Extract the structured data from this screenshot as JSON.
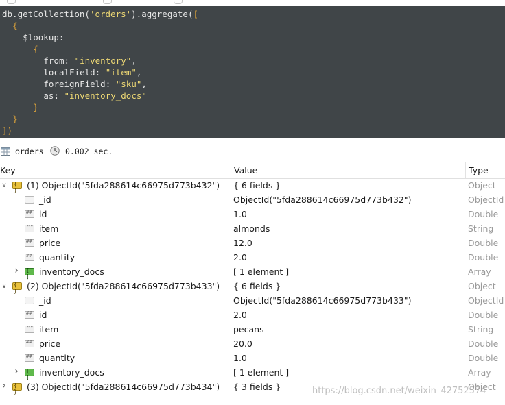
{
  "editor": {
    "lines": [
      {
        "indent": 0,
        "parts": [
          {
            "t": "db.getCollection(",
            "c": "c-plain"
          },
          {
            "t": "'orders'",
            "c": "c-str"
          },
          {
            "t": ").aggregate(",
            "c": "c-plain"
          },
          {
            "t": "[",
            "c": "c-bracket"
          }
        ]
      },
      {
        "indent": 2,
        "parts": [
          {
            "t": "{",
            "c": "c-bracket"
          }
        ]
      },
      {
        "indent": 4,
        "parts": [
          {
            "t": "$lookup:",
            "c": "c-key"
          }
        ]
      },
      {
        "indent": 6,
        "parts": [
          {
            "t": "{",
            "c": "c-bracket"
          }
        ]
      },
      {
        "indent": 8,
        "parts": [
          {
            "t": "from: ",
            "c": "c-key"
          },
          {
            "t": "\"inventory\"",
            "c": "c-str"
          },
          {
            "t": ",",
            "c": "c-plain"
          }
        ]
      },
      {
        "indent": 8,
        "parts": [
          {
            "t": "localField: ",
            "c": "c-key"
          },
          {
            "t": "\"item\"",
            "c": "c-str"
          },
          {
            "t": ",",
            "c": "c-plain"
          }
        ]
      },
      {
        "indent": 8,
        "parts": [
          {
            "t": "foreignField: ",
            "c": "c-key"
          },
          {
            "t": "\"sku\"",
            "c": "c-str"
          },
          {
            "t": ",",
            "c": "c-plain"
          }
        ]
      },
      {
        "indent": 8,
        "parts": [
          {
            "t": "as: ",
            "c": "c-key"
          },
          {
            "t": "\"inventory_docs\"",
            "c": "c-str"
          }
        ]
      },
      {
        "indent": 6,
        "parts": [
          {
            "t": "}",
            "c": "c-bracket"
          }
        ]
      },
      {
        "indent": 2,
        "parts": [
          {
            "t": "}",
            "c": "c-bracket"
          }
        ]
      },
      {
        "indent": 0,
        "parts": [
          {
            "t": "])",
            "c": "c-bracket"
          }
        ]
      }
    ]
  },
  "status": {
    "collection": "orders",
    "time": "0.002 sec."
  },
  "grid": {
    "headers": {
      "key": "Key",
      "value": "Value",
      "type": "Type"
    },
    "rows": [
      {
        "level": 0,
        "arrow": "down",
        "icon": "object",
        "key": "(1) ObjectId(\"5fda288614c66975d773b432\")",
        "value": "{ 6 fields }",
        "type": "Object"
      },
      {
        "level": 1,
        "arrow": "",
        "icon": "id",
        "key": "_id",
        "value": "ObjectId(\"5fda288614c66975d773b432\")",
        "type": "ObjectId"
      },
      {
        "level": 1,
        "arrow": "",
        "icon": "number",
        "key": "id",
        "value": "1.0",
        "type": "Double"
      },
      {
        "level": 1,
        "arrow": "",
        "icon": "string",
        "key": "item",
        "value": "almonds",
        "type": "String"
      },
      {
        "level": 1,
        "arrow": "",
        "icon": "number",
        "key": "price",
        "value": "12.0",
        "type": "Double"
      },
      {
        "level": 1,
        "arrow": "",
        "icon": "number",
        "key": "quantity",
        "value": "2.0",
        "type": "Double"
      },
      {
        "level": 1,
        "arrow": "right",
        "icon": "array",
        "key": "inventory_docs",
        "value": "[ 1 element ]",
        "type": "Array"
      },
      {
        "level": 0,
        "arrow": "down",
        "icon": "object",
        "key": "(2) ObjectId(\"5fda288614c66975d773b433\")",
        "value": "{ 6 fields }",
        "type": "Object"
      },
      {
        "level": 1,
        "arrow": "",
        "icon": "id",
        "key": "_id",
        "value": "ObjectId(\"5fda288614c66975d773b433\")",
        "type": "ObjectId"
      },
      {
        "level": 1,
        "arrow": "",
        "icon": "number",
        "key": "id",
        "value": "2.0",
        "type": "Double"
      },
      {
        "level": 1,
        "arrow": "",
        "icon": "string",
        "key": "item",
        "value": "pecans",
        "type": "String"
      },
      {
        "level": 1,
        "arrow": "",
        "icon": "number",
        "key": "price",
        "value": "20.0",
        "type": "Double"
      },
      {
        "level": 1,
        "arrow": "",
        "icon": "number",
        "key": "quantity",
        "value": "1.0",
        "type": "Double"
      },
      {
        "level": 1,
        "arrow": "right",
        "icon": "array",
        "key": "inventory_docs",
        "value": "[ 1 element ]",
        "type": "Array"
      },
      {
        "level": 0,
        "arrow": "right",
        "icon": "object",
        "key": "(3) ObjectId(\"5fda288614c66975d773b434\")",
        "value": "{ 3 fields }",
        "type": "Object"
      }
    ]
  },
  "watermark": "https://blog.csdn.net/weixin_42752574"
}
